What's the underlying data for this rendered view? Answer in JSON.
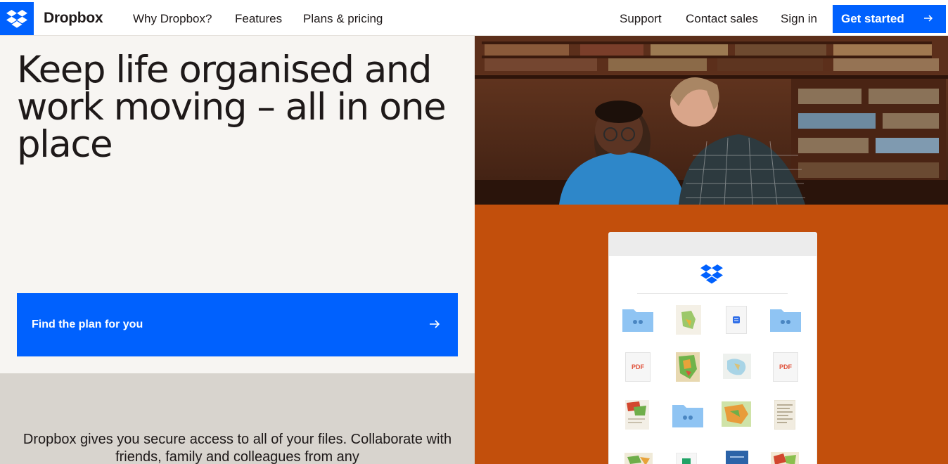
{
  "header": {
    "brand": "Dropbox",
    "nav_left": [
      "Why Dropbox?",
      "Features",
      "Plans & pricing"
    ],
    "nav_right": [
      "Support",
      "Contact sales",
      "Sign in"
    ],
    "cta": "Get started",
    "logo_icon": "dropbox-logo-icon",
    "cta_icon": "arrow-right-icon"
  },
  "hero": {
    "headline": "Keep life organised and work moving – all in one place",
    "cta": "Find the plan for you",
    "cta_icon": "arrow-right-icon",
    "description": "Dropbox gives you secure access to all of your files. Collaborate with friends, family and colleagues from any"
  },
  "file_grid": {
    "tiles": [
      "shared-folder",
      "map-image",
      "doc",
      "shared-folder",
      "pdf",
      "map-image",
      "map-image",
      "pdf",
      "map-image",
      "shared-folder",
      "map-image",
      "document-image"
    ],
    "pdf_label": "PDF"
  },
  "colors": {
    "accent": "#0061fe",
    "hero_bg": "#f7f5f2",
    "sub_bg": "#d8d4ce",
    "orange_panel": "#c24f0c",
    "folder": "#8fc4f3"
  }
}
